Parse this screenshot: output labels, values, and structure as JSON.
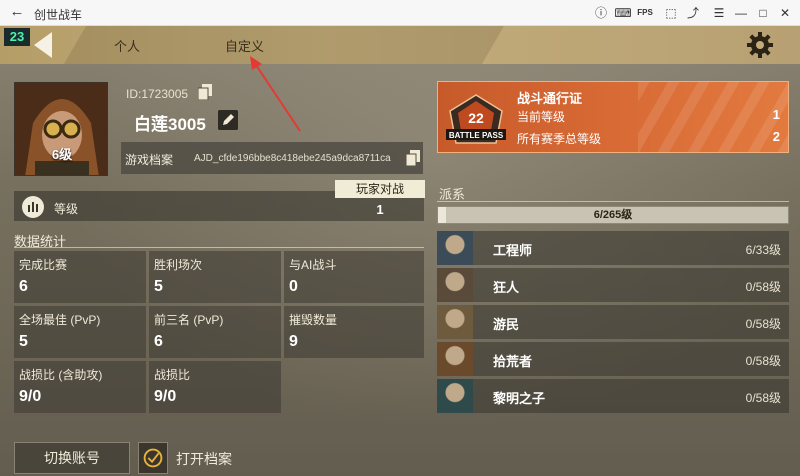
{
  "window": {
    "title": "创世战车",
    "controls": [
      "help-icon",
      "keyboard-icon",
      "fps-icon",
      "fullscreen-icon",
      "pin-icon",
      "menu-icon",
      "minimize-icon",
      "maximize-icon",
      "close-icon"
    ],
    "fps_label": "FPS"
  },
  "topnav": {
    "level": "23",
    "tabs": [
      "个人",
      "自定义"
    ]
  },
  "profile": {
    "id": "ID:1723005",
    "name": "白莲3005",
    "avatar_level": "6级",
    "archive_label": "游戏档案",
    "archive_code": "AJD_cfde196bbe8c418ebe245a9dca8711ca",
    "level_label": "等级",
    "pvp_header": "玩家对战",
    "pvp_value": "1"
  },
  "stats": {
    "title": "数据统计",
    "items": [
      {
        "label": "完成比赛",
        "value": "6"
      },
      {
        "label": "胜利场次",
        "value": "5"
      },
      {
        "label": "与AI战斗",
        "value": "0"
      },
      {
        "label": "全场最佳 (PvP)",
        "value": "5"
      },
      {
        "label": "前三名 (PvP)",
        "value": "6"
      },
      {
        "label": "摧毁数量",
        "value": "9"
      },
      {
        "label": "战损比 (含助攻)",
        "value": "9/0"
      },
      {
        "label": "战损比",
        "value": "9/0"
      }
    ]
  },
  "actions": {
    "switch_account": "切换账号",
    "open_archive": "打开档案"
  },
  "battle_pass": {
    "emblem_number": "22",
    "emblem_text": "BATTLE PASS",
    "title": "战斗通行证",
    "current_label": "当前等级",
    "current_value": "1",
    "total_label": "所有赛季总等级",
    "total_value": "2"
  },
  "factions": {
    "title": "派系",
    "progress_text": "6/265级",
    "progress": 0.023,
    "items": [
      {
        "name": "工程师",
        "level": "6/33级",
        "color": "#3b4b57"
      },
      {
        "name": "狂人",
        "level": "0/58级",
        "color": "#5a4a3a"
      },
      {
        "name": "游民",
        "level": "0/58级",
        "color": "#6e5a3c"
      },
      {
        "name": "拾荒者",
        "level": "0/58级",
        "color": "#6a4a2a"
      },
      {
        "name": "黎明之子",
        "level": "0/58级",
        "color": "#2f4a4a"
      }
    ]
  },
  "colors": {
    "nav_gold": "#c4ad7a",
    "battle_pass_orange": "#d86a35",
    "level_badge_green": "#4ef0b0",
    "annotation_red": "#e53935"
  }
}
